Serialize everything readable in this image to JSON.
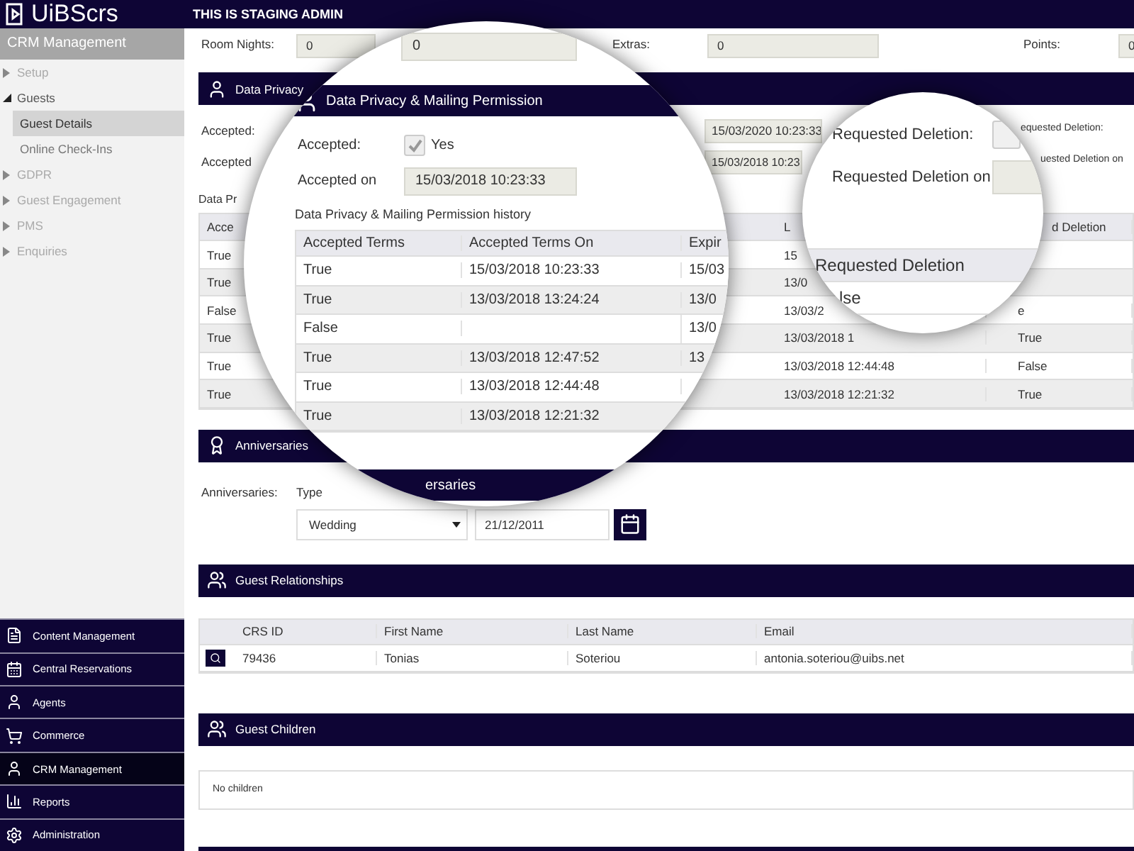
{
  "header": {
    "logo": "UiBScrs",
    "banner": "THIS IS STAGING ADMIN"
  },
  "sidebar": {
    "title": "CRM Management",
    "tree": [
      {
        "label": "Setup",
        "expanded": false
      },
      {
        "label": "Guests",
        "expanded": true,
        "children": [
          {
            "label": "Guest Details",
            "selected": true
          },
          {
            "label": "Online Check-Ins",
            "selected": false
          }
        ]
      },
      {
        "label": "GDPR",
        "expanded": false
      },
      {
        "label": "Guest Engagement",
        "expanded": false
      },
      {
        "label": "PMS",
        "expanded": false
      },
      {
        "label": "Enquiries",
        "expanded": false
      }
    ],
    "modules": [
      {
        "label": "Content Management",
        "selected": false
      },
      {
        "label": "Central Reservations",
        "selected": false
      },
      {
        "label": "Agents",
        "selected": false
      },
      {
        "label": "Commerce",
        "selected": false
      },
      {
        "label": "CRM Management",
        "selected": true
      },
      {
        "label": "Reports",
        "selected": false
      },
      {
        "label": "Administration",
        "selected": false
      }
    ]
  },
  "stats": [
    {
      "label": "Room Nights:",
      "value": "0"
    },
    {
      "label": "Extras:",
      "value": "0"
    },
    {
      "label": "Points:",
      "value": "0"
    }
  ],
  "privacy": {
    "title": "Data Privacy",
    "accepted_label": "Accepted:",
    "accepted_on_label": "Accepted",
    "dates": [
      "15/03/2020 10:23:33",
      "15/03/2018 10:23"
    ],
    "requested_labels": [
      "equested Deletion:",
      "uested Deletion on"
    ],
    "history_title": "Data Pr",
    "table": {
      "columns": [
        "Acce",
        "L",
        "d Deletion"
      ],
      "rows": [
        {
          "col_1": "True",
          "col_2": "15"
        },
        {
          "col_1": "True",
          "col_2": "13/0"
        },
        {
          "col_1": "False",
          "col_2": "13/03/2",
          "col_3": "e"
        },
        {
          "col_1": "True",
          "col_2": "13/03/2018 1",
          "col_3": "True"
        },
        {
          "col_1": "True",
          "col_2": "13/03/2018 12:44:48",
          "col_3": "False"
        },
        {
          "col_1": "True",
          "col_2": "13/03/2018 12:21:32",
          "col_3": "True"
        }
      ]
    }
  },
  "magnifier_1": {
    "room_nights_value": "0",
    "title": "Data Privacy & Mailing Permission",
    "accepted": {
      "label": "Accepted:",
      "checked": true,
      "text": "Yes"
    },
    "accepted_on": {
      "label": "Accepted on",
      "value": "15/03/2018 10:23:33"
    },
    "history_title": "Data Privacy & Mailing Permission history",
    "table": {
      "columns": [
        "Accepted Terms",
        "Accepted Terms On",
        "Expir"
      ],
      "rows": [
        {
          "col_1": "True",
          "col_2": "15/03/2018 10:23:33",
          "col_3": "15/03"
        },
        {
          "col_1": "True",
          "col_2": "13/03/2018 13:24:24",
          "col_3": "13/0"
        },
        {
          "col_1": "False",
          "col_3": "13/0"
        },
        {
          "col_1": "True",
          "col_2": "13/03/2018 12:47:52",
          "col_3": "13"
        },
        {
          "col_1": "True",
          "col_2": "13/03/2018 12:44:48"
        },
        {
          "col_1": "True",
          "col_2": "13/03/2018 12:21:32"
        }
      ]
    },
    "next_section": "ersaries"
  },
  "magnifier_2": {
    "requested": {
      "label": "Requested Deletion:",
      "checked": false
    },
    "requested_on": {
      "label": "Requested Deletion on"
    },
    "table": {
      "columns": [
        "Requested Deletion"
      ],
      "rows": [
        {
          "col_1": "lse"
        }
      ]
    }
  },
  "anniversaries": {
    "title": "Anniversaries",
    "label": "Anniversaries:",
    "type_label": "Type",
    "type_value": "Wedding",
    "date": "21/12/2011"
  },
  "relationships": {
    "title": "Guest Relationships",
    "columns": [
      "CRS ID",
      "First Name",
      "Last Name",
      "Email"
    ],
    "rows": [
      [
        "79436",
        "Tonias",
        "Soteriou",
        "antonia.soteriou@uibs.net"
      ]
    ]
  },
  "guest_children": {
    "title": "Guest Children",
    "empty_text": "No children"
  }
}
